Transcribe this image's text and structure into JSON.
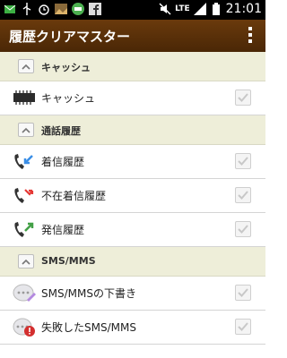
{
  "status_bar": {
    "lte_label": "LTE",
    "time": "21:01"
  },
  "app_bar": {
    "title": "履歴クリアマスター"
  },
  "sections": [
    {
      "label": "キャッシュ",
      "items": [
        {
          "label": "キャッシュ",
          "icon": "memory-chip-icon"
        }
      ]
    },
    {
      "label": "通話履歴",
      "items": [
        {
          "label": "着信履歴",
          "icon": "incoming-call-icon"
        },
        {
          "label": "不在着信履歴",
          "icon": "missed-call-icon"
        },
        {
          "label": "発信履歴",
          "icon": "outgoing-call-icon"
        }
      ]
    },
    {
      "label": "SMS/MMS",
      "items": [
        {
          "label": "SMS/MMSの下書き",
          "icon": "draft-message-icon"
        },
        {
          "label": "失敗したSMS/MMS",
          "icon": "failed-message-icon"
        }
      ]
    }
  ]
}
